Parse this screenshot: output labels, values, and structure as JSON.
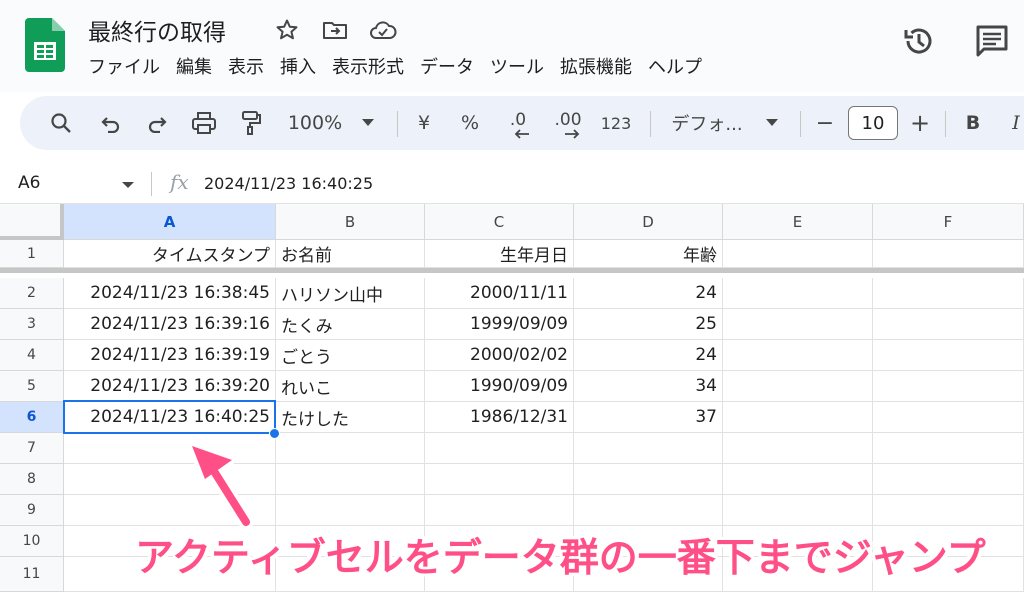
{
  "document": {
    "title": "最終行の取得"
  },
  "menu": [
    "ファイル",
    "編集",
    "表示",
    "挿入",
    "表示形式",
    "データ",
    "ツール",
    "拡張機能",
    "ヘルプ"
  ],
  "toolbar": {
    "zoom": "100%",
    "currency": "¥",
    "percent": "%",
    "decrease_decimal": ".0",
    "increase_decimal": ".00",
    "number_format": "123",
    "font": "デフォ...",
    "font_size": "10",
    "minus": "−",
    "plus": "+",
    "bold": "B",
    "italic": "I"
  },
  "formula_bar": {
    "name_box": "A6",
    "fx": "fx",
    "value": "2024/11/23 16:40:25"
  },
  "grid": {
    "columns": [
      "A",
      "B",
      "C",
      "D",
      "E",
      "F"
    ],
    "rows": [
      "1",
      "2",
      "3",
      "4",
      "5",
      "6",
      "7",
      "8",
      "9",
      "10",
      "11"
    ],
    "header_row": [
      "タイムスタンプ",
      "お名前",
      "生年月日",
      "年齢"
    ],
    "data": [
      [
        "2024/11/23 16:38:45",
        "ハリソン山中",
        "2000/11/11",
        "24"
      ],
      [
        "2024/11/23 16:39:16",
        "たくみ",
        "1999/09/09",
        "25"
      ],
      [
        "2024/11/23 16:39:19",
        "ごとう",
        "2000/02/02",
        "24"
      ],
      [
        "2024/11/23 16:39:20",
        "れいこ",
        "1990/09/09",
        "34"
      ],
      [
        "2024/11/23 16:40:25",
        "たけした",
        "1986/12/31",
        "37"
      ]
    ],
    "active_cell": "A6"
  },
  "annotation": {
    "text": "アクティブセルをデータ群の一番下までジャンプ",
    "color": "#ff4f87"
  },
  "colors": {
    "accent": "#1a73e8",
    "sheets_green": "#0f9d58",
    "selected_header": "#d3e3fd"
  }
}
